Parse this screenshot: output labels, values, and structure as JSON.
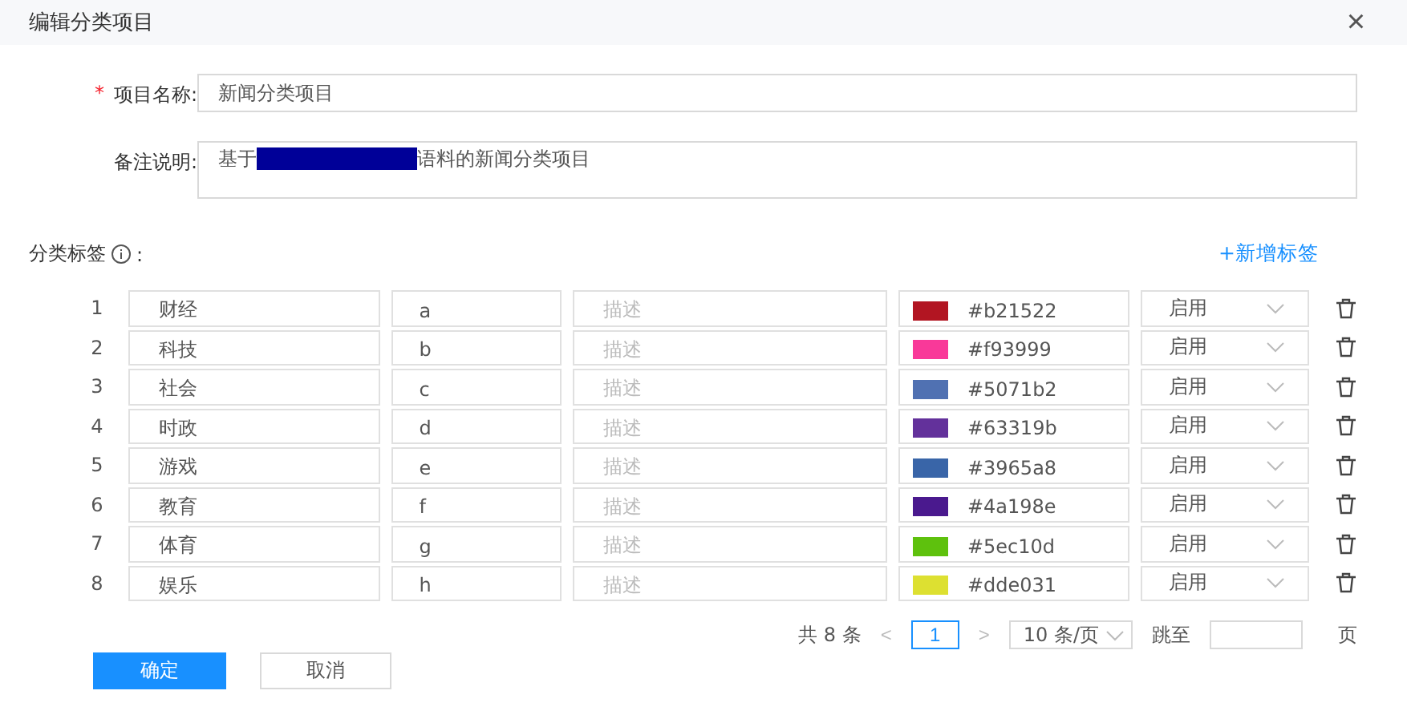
{
  "dialog": {
    "title": "编辑分类项目",
    "close": "×"
  },
  "name_field": {
    "required_mark": "*",
    "label": "项目名称:",
    "value": "新闻分类项目"
  },
  "remark_field": {
    "label": "备注说明:",
    "before": "基于",
    "redacted": true,
    "after": "语料的新闻分类项目"
  },
  "tags": {
    "label": "分类标签",
    "suffix": ":",
    "add": "+新增标签"
  },
  "rows": [
    {
      "index": "1",
      "name": "财经",
      "code": "a",
      "placeholder": "描述",
      "color": "#b21522",
      "hex": "#b21522",
      "status": "启用"
    },
    {
      "index": "2",
      "name": "科技",
      "code": "b",
      "placeholder": "描述",
      "color": "#f93999",
      "hex": "#f93999",
      "status": "启用"
    },
    {
      "index": "3",
      "name": "社会",
      "code": "c",
      "placeholder": "描述",
      "color": "#5071b2",
      "hex": "#5071b2",
      "status": "启用"
    },
    {
      "index": "4",
      "name": "时政",
      "code": "d",
      "placeholder": "描述",
      "color": "#63319b",
      "hex": "#63319b",
      "status": "启用"
    },
    {
      "index": "5",
      "name": "游戏",
      "code": "e",
      "placeholder": "描述",
      "color": "#3965a8",
      "hex": "#3965a8",
      "status": "启用"
    },
    {
      "index": "6",
      "name": "教育",
      "code": "f",
      "placeholder": "描述",
      "color": "#4a198e",
      "hex": "#4a198e",
      "status": "启用"
    },
    {
      "index": "7",
      "name": "体育",
      "code": "g",
      "placeholder": "描述",
      "color": "#5ec10d",
      "hex": "#5ec10d",
      "status": "启用"
    },
    {
      "index": "8",
      "name": "娱乐",
      "code": "h",
      "placeholder": "描述",
      "color": "#dde031",
      "hex": "#dde031",
      "status": "启用"
    }
  ],
  "pagination": {
    "total": "共 8 条",
    "prev": "<",
    "pages": [
      {
        "label": "1",
        "selected": true
      }
    ],
    "next": ">",
    "page_size": "10 条/页",
    "jump_label": "跳至",
    "jump_suffix": "页"
  },
  "buttons": [
    {
      "label": "确定",
      "kind": "primary"
    },
    {
      "label": "取消",
      "kind": "default"
    }
  ]
}
